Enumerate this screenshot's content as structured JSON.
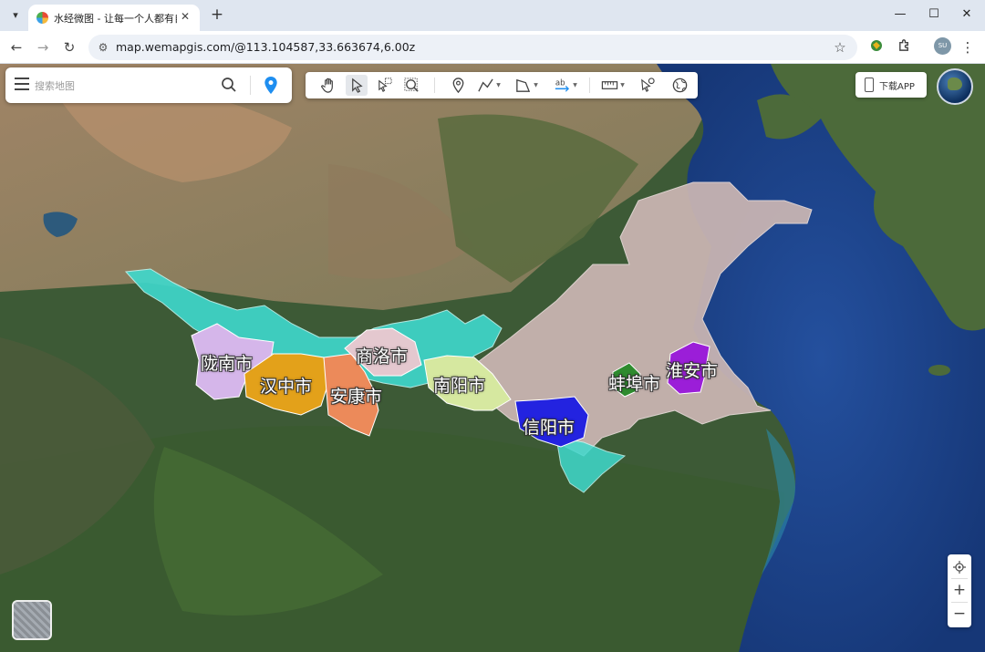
{
  "browser": {
    "tab_title": "水经微图 - 让每一个人都有自己",
    "url": "map.wemapgis.com/@113.104587,33.663674,6.00z",
    "profile_initials": "SU",
    "icons": [
      "tab-search-icon",
      "favicon",
      "close-icon",
      "new-tab-icon",
      "minimize-icon",
      "maximize-icon",
      "window-close-icon",
      "back-icon",
      "forward-icon",
      "reload-icon",
      "site-info-icon",
      "star-icon",
      "extension-icon",
      "puzzle-icon",
      "more-icon"
    ]
  },
  "map": {
    "search": {
      "placeholder": "搜索地图",
      "icons": [
        "menu-icon",
        "search-icon",
        "location-pin-icon"
      ]
    },
    "toolbar": {
      "tools": [
        "pan-hand-icon",
        "select-arrow-icon",
        "box-select-icon",
        "zoom-area-icon",
        "marker-icon",
        "polyline-icon",
        "polygon-icon",
        "text-label-icon",
        "measure-ruler-icon",
        "identify-icon",
        "globe-icon"
      ],
      "active_tool": "select-arrow-icon"
    },
    "download_label": "下载APP",
    "zoom": {
      "in_label": "+",
      "out_label": "−"
    },
    "regions": [
      {
        "label": "陇南市",
        "color": "#d5b6ea"
      },
      {
        "label": "汉中市",
        "color": "#e3a11a"
      },
      {
        "label": "安康市",
        "color": "#ec8a5a"
      },
      {
        "label": "商洛市",
        "color": "#e4c8cf"
      },
      {
        "label": "南阳市",
        "color": "#d6e8a0"
      },
      {
        "label": "信阳市",
        "color": "#2323e0"
      },
      {
        "label": "蚌埠市",
        "color": "#2e8b2e"
      },
      {
        "label": "淮安市",
        "color": "#9b1ed8"
      }
    ],
    "colors": {
      "belt": "#3fd9cd",
      "huaihe_plain": "#cbb6b3",
      "sea": "#1c3f88",
      "land": "#3d5a36"
    }
  }
}
